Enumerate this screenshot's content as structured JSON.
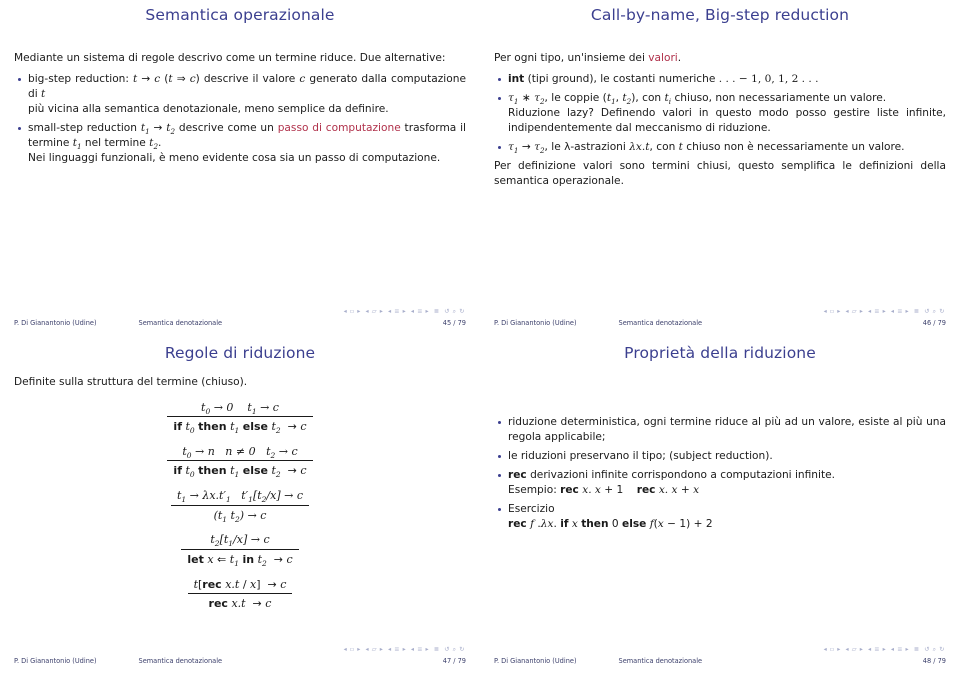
{
  "document": {
    "kind": "beamer-handout-4up",
    "author": "P. Di Gianantonio  (Udine)",
    "course": "Semantica denotazionale",
    "nav_symbols": "◂ ◻ ▸ ◂ 🖅 ▸ ◂ ≣ ▸ ◂ ≣ ▸  ≣  ↺ ⌕ ↻"
  },
  "colors": {
    "title_blue": "#3b3f8f",
    "accent_red": "#b0304a",
    "text": "#1a1a1a",
    "footer": "#3b3f6b",
    "nav": "#a8aecb"
  },
  "slides": [
    {
      "title": "Semantica operazionale",
      "intro": "Mediante un sistema di regole descrivo come un termine riduce. Due alternative:",
      "bullets": [
        {
          "lines": [
            "big-step reduction: t → c (t ⇒ c) descrive il valore c generato dalla computazione di t",
            "più vicina alla semantica denotazionale, meno semplice da definire."
          ]
        },
        {
          "lines": [
            "small-step reduction t₁ → t₂ descrive come un passo di computazione trasforma il termine t₁ nel termine t₂.",
            "Nei linguaggi funzionali, è meno evidente cosa sia un passo di computazione."
          ],
          "highlight": "passo di computazione"
        }
      ],
      "footer": {
        "author": "P. Di Gianantonio  (Udine)",
        "course": "Semantica denotazionale",
        "page": "45 / 79"
      }
    },
    {
      "title": "Call-by-name, Big-step reduction",
      "intro": "Per ogni tipo, un'insieme dei valori.",
      "intro_highlight": "valori",
      "bullets": [
        {
          "lines": [
            "int (tipi ground), le costanti numeriche . . . − 1, 0, 1, 2 . . ."
          ]
        },
        {
          "lines": [
            "τ₁ ∗ τ₂, le coppie (t₁, t₂), con tᵢ chiuso, non necessariamente un valore.",
            "Riduzione lazy? Definendo valori in questo modo posso gestire liste infinite, indipendentemente dal meccanismo di riduzione."
          ]
        },
        {
          "lines": [
            "τ₁ → τ₂, le λ-astrazioni λx.t, con t chiuso non è necessariamente un valore."
          ]
        }
      ],
      "outro": "Per definizione valori sono termini chiusi, questo semplifica le definizioni della semantica operazionale.",
      "footer": {
        "author": "P. Di Gianantonio  (Udine)",
        "course": "Semantica denotazionale",
        "page": "46 / 79"
      }
    },
    {
      "title": "Regole di riduzione",
      "intro": "Definite sulla struttura del termine (chiuso).",
      "rules": [
        {
          "numerator": "t₀ → 0    t₁ → c",
          "denominator": "if t₀ then t₁ else t₂  → c"
        },
        {
          "numerator": "t₀ → n   n ≠ 0   t₂ → c",
          "denominator": "if t₀ then t₁ else t₂  → c"
        },
        {
          "numerator": "t₁ → λx.t′₁   t′₁[t₂/x] → c",
          "denominator": "(t₁ t₂)  → c"
        },
        {
          "numerator": "t₂[t₁/x] → c",
          "denominator": "let x ⇐ t₁ in t₂  → c"
        },
        {
          "numerator": "t[rec x.t / x]  → c",
          "denominator": "rec x.t  → c"
        }
      ],
      "footer": {
        "author": "P. Di Gianantonio  (Udine)",
        "course": "Semantica denotazionale",
        "page": "47 / 79"
      }
    },
    {
      "title": "Proprietà della riduzione",
      "bullets": [
        {
          "lines": [
            "riduzione deterministica, ogni termine riduce al più ad un valore, esiste al più una regola applicabile;"
          ]
        },
        {
          "lines": [
            "le riduzioni preservano il tipo; (subject reduction)."
          ]
        },
        {
          "lines": [
            "rec derivazioni infinite corrispondono a computazioni infinite.",
            "Esempio:  rec x. x + 1    rec x. x + x"
          ]
        },
        {
          "lines": [
            "Esercizio",
            "rec f .λx. if x then 0 else f(x − 1) + 2"
          ]
        }
      ],
      "footer": {
        "author": "P. Di Gianantonio  (Udine)",
        "course": "Semantica denotazionale",
        "page": "48 / 79"
      }
    }
  ]
}
